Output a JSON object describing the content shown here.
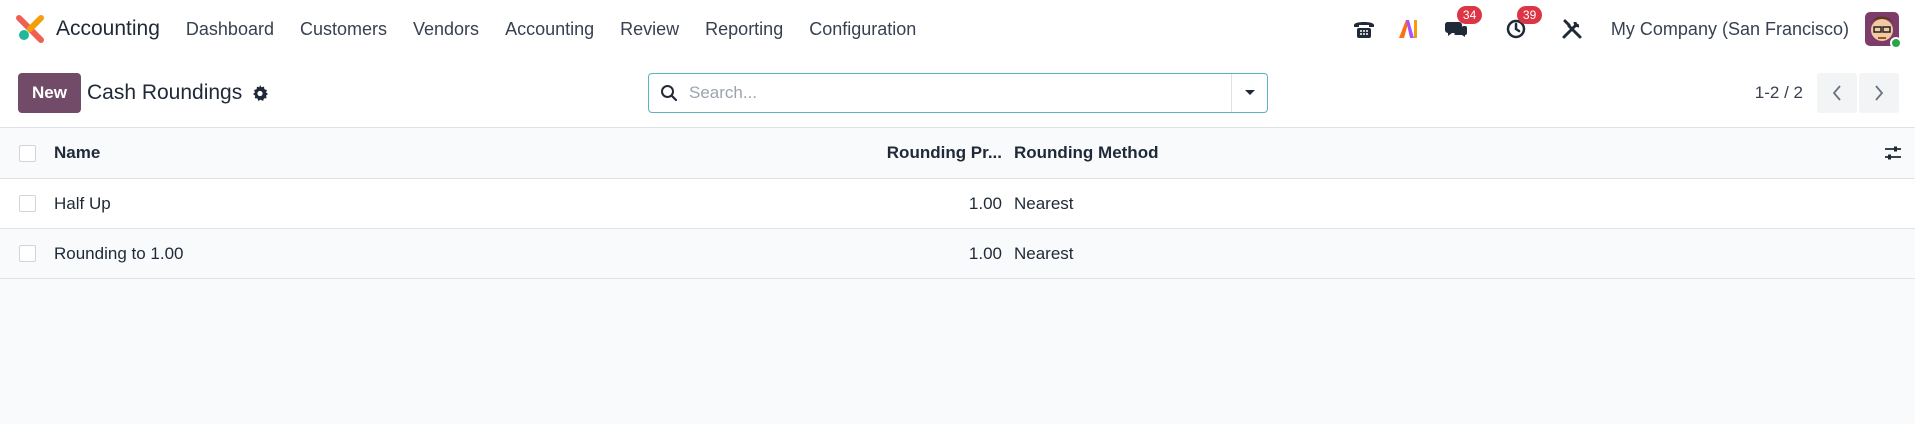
{
  "app": {
    "name": "Accounting",
    "logo_colors": [
      "#f06050",
      "#7c3aed",
      "#21b799"
    ]
  },
  "menu": [
    {
      "label": "Dashboard"
    },
    {
      "label": "Customers"
    },
    {
      "label": "Vendors"
    },
    {
      "label": "Accounting"
    },
    {
      "label": "Review"
    },
    {
      "label": "Reporting"
    },
    {
      "label": "Configuration"
    }
  ],
  "systray": {
    "phone_icon": "phone-icon",
    "ai_icon": "ai-icon",
    "messages_badge": "34",
    "activities_badge": "39",
    "debug_icon": "tools-icon",
    "company": "My Company (San Francisco)"
  },
  "control": {
    "new_label": "New",
    "title": "Cash Roundings",
    "search_placeholder": "Search...",
    "pager": "1-2 / 2"
  },
  "table": {
    "columns": {
      "name": "Name",
      "precision": "Rounding Pr...",
      "method": "Rounding Method"
    },
    "rows": [
      {
        "name": "Half Up",
        "precision": "1.00",
        "method": "Nearest"
      },
      {
        "name": "Rounding to 1.00",
        "precision": "1.00",
        "method": "Nearest"
      }
    ]
  },
  "colors": {
    "primary": "#714b67",
    "badge": "#dc3545",
    "search_border": "#5cb3c0"
  }
}
